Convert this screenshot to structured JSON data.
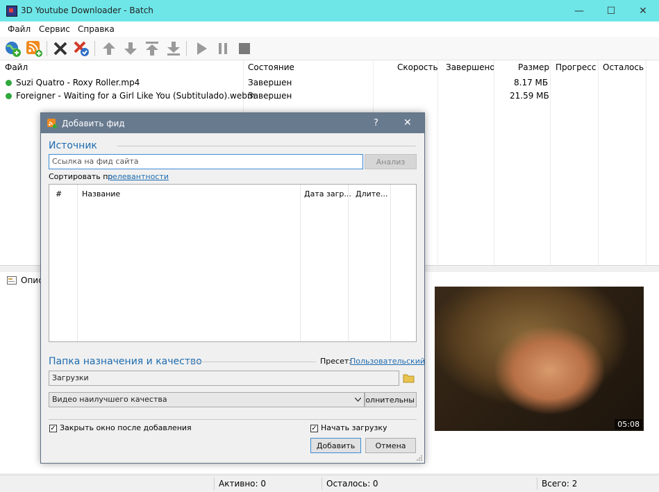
{
  "window": {
    "title": "3D Youtube Downloader - Batch",
    "minimize": "—",
    "maximize": "☐",
    "close": "✕"
  },
  "menu": [
    "Файл",
    "Сервис",
    "Справка"
  ],
  "toolbar_icons": [
    "add-url-icon",
    "add-feed-icon",
    "delete-icon",
    "delete-completed-icon",
    "move-up-icon",
    "move-down-icon",
    "move-top-icon",
    "move-bottom-icon",
    "start-icon",
    "pause-icon",
    "stop-icon"
  ],
  "list": {
    "columns": [
      "Файл",
      "Состояние",
      "Скорость",
      "Завершено",
      "Размер",
      "Прогресс",
      "Осталось"
    ],
    "rows": [
      {
        "file": "Suzi Quatro - Roxy Roller.mp4",
        "status": "Завершен",
        "size": "8.17 МБ"
      },
      {
        "file": "Foreigner - Waiting for a Girl Like You (Subtitulado).webm",
        "status": "Завершен",
        "size": "21.59 МБ"
      }
    ]
  },
  "lower_tab": "Описа",
  "video_time": "05:08",
  "statusbar": {
    "active": "Активно: 0",
    "remaining": "Осталось: 0",
    "total": "Всего: 2"
  },
  "dialog": {
    "title": "Добавить фид",
    "help": "?",
    "close": "✕",
    "source_title": "Источник",
    "url_placeholder": "Ссылка на фид сайта",
    "analyze_button": "Анализ",
    "sort_label": "Сортировать по",
    "sort_value": "релевантности",
    "table_columns": [
      "#",
      "Название",
      "Дата загр...",
      "Длите..."
    ],
    "dest_title": "Папка назначения и качество",
    "preset_label": "Пресет:",
    "preset_value": "Пользовательский",
    "folder": "Загрузки",
    "quality": "Видео наилучшего качества",
    "advanced_button": "ополнительны",
    "close_after_add": "Закрыть окно после добавления",
    "start_download": "Начать загрузку",
    "add_button": "Добавить",
    "cancel_button": "Отмена"
  },
  "colors": {
    "titlebar": "#6ee6e8",
    "dialog_title": "#687a8e",
    "accent": "#1d6bb0",
    "status_ok": "#2fa83c"
  }
}
